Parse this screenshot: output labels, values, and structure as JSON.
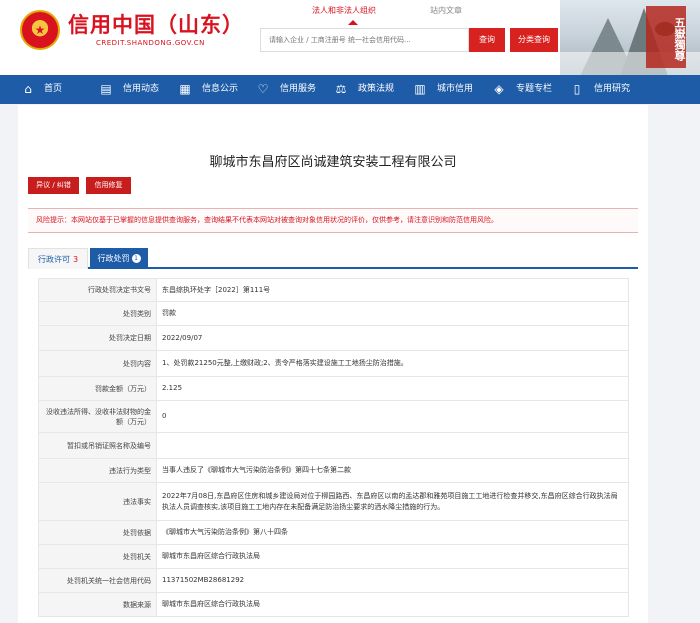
{
  "header": {
    "emblem_glyph": "★",
    "title": "信用中国（山东）",
    "domain": "CREDIT.SHANDONG.GOV.CN",
    "search_tabs": [
      "法人和非法人组织",
      "站内文章"
    ],
    "search_placeholder": "请输入企业 / 工商注册号 统一社会信用代码...",
    "query_button": "查询",
    "class_query_button": "分类查询",
    "seal_text": "五嶽獨尊"
  },
  "nav": {
    "items": [
      {
        "label": "首页",
        "icon": "home-icon"
      },
      {
        "label": "信用动态",
        "icon": "news-icon"
      },
      {
        "label": "信息公示",
        "icon": "publicity-icon"
      },
      {
        "label": "信用服务",
        "icon": "heart-icon"
      },
      {
        "label": "政策法规",
        "icon": "policy-icon"
      },
      {
        "label": "城市信用",
        "icon": "city-icon"
      },
      {
        "label": "专题专栏",
        "icon": "layers-icon"
      },
      {
        "label": "信用研究",
        "icon": "book-icon"
      }
    ]
  },
  "company": {
    "name": "聊城市东昌府区尚诚建筑安装工程有限公司",
    "objection_button": "异议 / 纠错",
    "repair_button": "信用修复"
  },
  "warning": {
    "label": "风险提示：",
    "text": "本网站仅基于已掌握的信息提供查询服务，查询结果不代表本网站对被查询对象信用状况的评价，仅供参考，请注意识别和防范信用风险。"
  },
  "tabs": [
    {
      "label": "行政许可",
      "count": "3"
    },
    {
      "label": "行政处罚",
      "count": "1"
    }
  ],
  "detail": {
    "rows": [
      {
        "key": "行政处罚决定书文号",
        "value": "东昌综执环处字［2022］第111号"
      },
      {
        "key": "处罚类别",
        "value": "罚款"
      },
      {
        "key": "处罚决定日期",
        "value": "2022/09/07"
      },
      {
        "key": "处罚内容",
        "value": "1、处罚款21250元整,上缴财政;2、责令严格落实建设施工工地扬尘防治措施。"
      },
      {
        "key": "罚款金额（万元）",
        "value": "2.125"
      },
      {
        "key": "没收违法所得、没收非法财物的金额（万元）",
        "value": "0"
      },
      {
        "key": "暂扣或吊销证照名称及编号",
        "value": ""
      },
      {
        "key": "违法行为类型",
        "value": "当事人违反了《聊城市大气污染防治条例》第四十七条第二款"
      },
      {
        "key": "违法事实",
        "value": "2022年7月08日,东昌府区住房和城乡建设局对位于柳园路西、东昌府区以南的孟达郡和雅苑项目施工工地进行检查并移交,东昌府区综合行政执法局执法人员调查核实,该项目施工工地内存在未配备满足防治扬尘要求的洒水降尘措施的行为。"
      },
      {
        "key": "处罚依据",
        "value": "《聊城市大气污染防治条例》第八十四条"
      },
      {
        "key": "处罚机关",
        "value": "聊城市东昌府区综合行政执法局"
      },
      {
        "key": "处罚机关统一社会信用代码",
        "value": "11371502MB28681292"
      },
      {
        "key": "数据来源",
        "value": "聊城市东昌府区综合行政执法局"
      }
    ]
  }
}
